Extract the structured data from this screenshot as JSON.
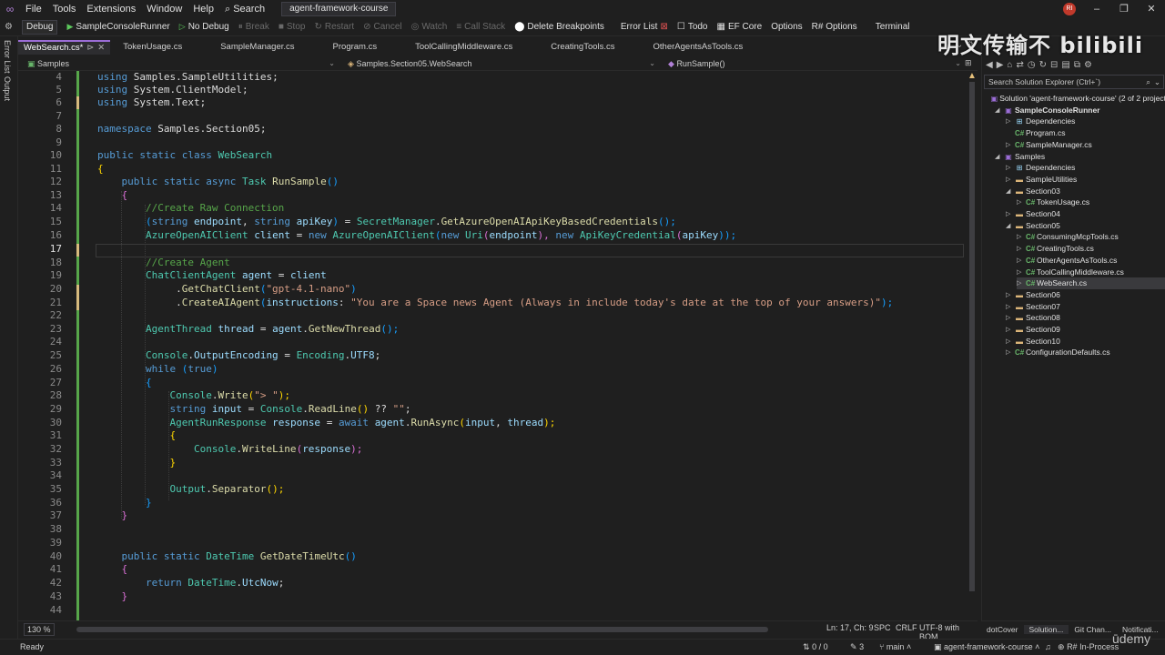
{
  "menubar": {
    "items": [
      "File",
      "Tools",
      "Extensions",
      "Window",
      "Help"
    ],
    "search_label": "Search",
    "solution_name": "agent-framework-course",
    "avatar_initials": "RI"
  },
  "toolbar": {
    "config": "Debug",
    "start_project": "SampleConsoleRunner",
    "no_debug": "No Debug",
    "break": "Break",
    "stop": "Stop",
    "restart": "Restart",
    "cancel": "Cancel",
    "watch": "Watch",
    "call_stack": "Call Stack",
    "delete_breakpoints": "Delete Breakpoints",
    "error_list": "Error List",
    "todo": "Todo",
    "ef_core": "EF Core",
    "options": "Options",
    "rsharp_options": "R# Options",
    "terminal": "Terminal"
  },
  "side_tabs": [
    "Error List",
    "Output"
  ],
  "doctabs": [
    {
      "label": "WebSearch.cs*",
      "active": true
    },
    {
      "label": "TokenUsage.cs"
    },
    {
      "label": "SampleManager.cs"
    },
    {
      "label": "Program.cs"
    },
    {
      "label": "ToolCallingMiddleware.cs"
    },
    {
      "label": "CreatingTools.cs"
    },
    {
      "label": "OtherAgentsAsTools.cs"
    }
  ],
  "navbar": {
    "project": "Samples",
    "type": "Samples.Section05.WebSearch",
    "member": "RunSample()"
  },
  "editor": {
    "line_numbers": [
      "4",
      "5",
      "6",
      "7",
      "8",
      "9",
      "10",
      "11",
      "12",
      "13",
      "14",
      "15",
      "16",
      "17",
      "18",
      "19",
      "20",
      "21",
      "22",
      "23",
      "24",
      "25",
      "26",
      "27",
      "28",
      "29",
      "30",
      "31",
      "32",
      "33",
      "34",
      "35",
      "36",
      "37",
      "38",
      "39",
      "40",
      "41",
      "42",
      "43",
      "44"
    ],
    "current_line": "17"
  },
  "code": {
    "l4": [
      "using",
      "Samples",
      ".",
      "SampleUtilities",
      ";"
    ],
    "l5": [
      "using",
      "System",
      ".",
      "ClientModel",
      ";"
    ],
    "l6": [
      "using",
      "System",
      ".",
      "Text",
      ";"
    ],
    "l8": [
      "namespace",
      "Samples",
      ".",
      "Section05",
      ";"
    ],
    "l10": [
      "public",
      "static",
      "class",
      "WebSearch"
    ],
    "l11": "{",
    "l12": [
      "public",
      "static",
      "async",
      "Task",
      "RunSample",
      "()"
    ],
    "l13": "{",
    "l14": "//Create Raw Connection",
    "l15": [
      "(",
      "string",
      "endpoint",
      ",",
      "string",
      "apiKey",
      ")",
      "=",
      "SecretManager",
      ".",
      "GetAzureOpenAIApiKeyBasedCredentials",
      "();"
    ],
    "l16": [
      "AzureOpenAIClient",
      "client",
      "=",
      "new",
      "AzureOpenAIClient",
      "(",
      "new",
      "Uri",
      "(",
      "endpoint",
      "),",
      "new",
      "ApiKeyCredential",
      "(",
      "apiKey",
      "));"
    ],
    "l18": "//Create Agent",
    "l19": [
      "ChatClientAgent",
      "agent",
      "=",
      "client"
    ],
    "l20": [
      ".",
      "GetChatClient",
      "(",
      "\"gpt-4.1-nano\"",
      ")"
    ],
    "l21": [
      ".",
      "CreateAIAgent",
      "(",
      "instructions",
      ":",
      "\"You are a Space news Agent (Always in include today's date at the top of your answers)\"",
      ");"
    ],
    "l23": [
      "AgentThread",
      "thread",
      "=",
      "agent",
      ".",
      "GetNewThread",
      "();"
    ],
    "l25": [
      "Console",
      ".",
      "OutputEncoding",
      "=",
      "Encoding",
      ".",
      "UTF8",
      ";"
    ],
    "l26": [
      "while",
      "(",
      "true",
      ")"
    ],
    "l27": "{",
    "l28": [
      "Console",
      ".",
      "Write",
      "(",
      "\"> \"",
      ");"
    ],
    "l29": [
      "string",
      "input",
      "=",
      "Console",
      ".",
      "ReadLine",
      "()",
      "??",
      "\"\"",
      ";"
    ],
    "l30": [
      "AgentRunResponse",
      "response",
      "=",
      "await",
      "agent",
      ".",
      "RunAsync",
      "(",
      "input",
      ",",
      "thread",
      ");"
    ],
    "l31": "{",
    "l32": [
      "Console",
      ".",
      "WriteLine",
      "(",
      "response",
      ");"
    ],
    "l33": "}",
    "l35": [
      "Output",
      ".",
      "Separator",
      "();"
    ],
    "l36": "}",
    "l37": "}",
    "l40": [
      "public",
      "static",
      "DateTime",
      "GetDateTimeUtc",
      "()"
    ],
    "l41": "{",
    "l42": [
      "return",
      "DateTime",
      ".",
      "UtcNow",
      ";"
    ],
    "l43": "}"
  },
  "editor_status": {
    "zoom": "130 %",
    "position": "Ln: 17, Ch: 9",
    "spc": "SPC",
    "crlf": "CRLF",
    "encoding": "UTF-8 with BOM"
  },
  "solution_explorer": {
    "search_placeholder": "Search Solution Explorer (Ctrl+`)",
    "rows": [
      {
        "label": "Solution 'agent-framework-course' (2 of 2 project",
        "indent": 0,
        "icon": "sol",
        "arrow": ""
      },
      {
        "label": "SampleConsoleRunner",
        "indent": 1,
        "icon": "proj",
        "arrow": "open",
        "bold": true
      },
      {
        "label": "Dependencies",
        "indent": 2,
        "icon": "dep",
        "arrow": "closed"
      },
      {
        "label": "Program.cs",
        "indent": 2,
        "icon": "cs",
        "arrow": ""
      },
      {
        "label": "SampleManager.cs",
        "indent": 2,
        "icon": "cs",
        "arrow": "closed"
      },
      {
        "label": "Samples",
        "indent": 1,
        "icon": "proj",
        "arrow": "open"
      },
      {
        "label": "Dependencies",
        "indent": 2,
        "icon": "dep",
        "arrow": "closed"
      },
      {
        "label": "SampleUtilities",
        "indent": 2,
        "icon": "folder",
        "arrow": "closed"
      },
      {
        "label": "Section03",
        "indent": 2,
        "icon": "folder",
        "arrow": "open"
      },
      {
        "label": "TokenUsage.cs",
        "indent": 3,
        "icon": "cs",
        "arrow": "closed"
      },
      {
        "label": "Section04",
        "indent": 2,
        "icon": "folder",
        "arrow": "closed"
      },
      {
        "label": "Section05",
        "indent": 2,
        "icon": "folder",
        "arrow": "open"
      },
      {
        "label": "ConsumingMcpTools.cs",
        "indent": 3,
        "icon": "cs",
        "arrow": "closed"
      },
      {
        "label": "CreatingTools.cs",
        "indent": 3,
        "icon": "cs",
        "arrow": "closed"
      },
      {
        "label": "OtherAgentsAsTools.cs",
        "indent": 3,
        "icon": "cs",
        "arrow": "closed"
      },
      {
        "label": "ToolCallingMiddleware.cs",
        "indent": 3,
        "icon": "cs",
        "arrow": "closed"
      },
      {
        "label": "WebSearch.cs",
        "indent": 3,
        "icon": "cs",
        "arrow": "closed",
        "selected": true
      },
      {
        "label": "Section06",
        "indent": 2,
        "icon": "folder",
        "arrow": "closed"
      },
      {
        "label": "Section07",
        "indent": 2,
        "icon": "folder",
        "arrow": "closed"
      },
      {
        "label": "Section08",
        "indent": 2,
        "icon": "folder",
        "arrow": "closed"
      },
      {
        "label": "Section09",
        "indent": 2,
        "icon": "folder",
        "arrow": "closed"
      },
      {
        "label": "Section10",
        "indent": 2,
        "icon": "folder",
        "arrow": "closed"
      },
      {
        "label": "ConfigurationDefaults.cs",
        "indent": 2,
        "icon": "cs",
        "arrow": "closed"
      }
    ],
    "tabs": [
      "dotCover",
      "Solution...",
      "Git Chan...",
      "Notificati..."
    ]
  },
  "statusbar": {
    "ready": "Ready",
    "arrows": "0 / 0",
    "pencil_count": "3",
    "branch": "main",
    "repo": "agent-framework-course",
    "rsharp": "R# In-Process"
  },
  "watermark": {
    "text": "明文传输不 bilibili",
    "udemy": "ūdemy"
  },
  "colors": {
    "accent": "#9b6dd6",
    "keyword": "#569cd6",
    "type": "#4ec9b0",
    "method": "#dcdcaa",
    "string": "#d69d85",
    "comment": "#57a64a",
    "variable": "#9cdcfe"
  }
}
